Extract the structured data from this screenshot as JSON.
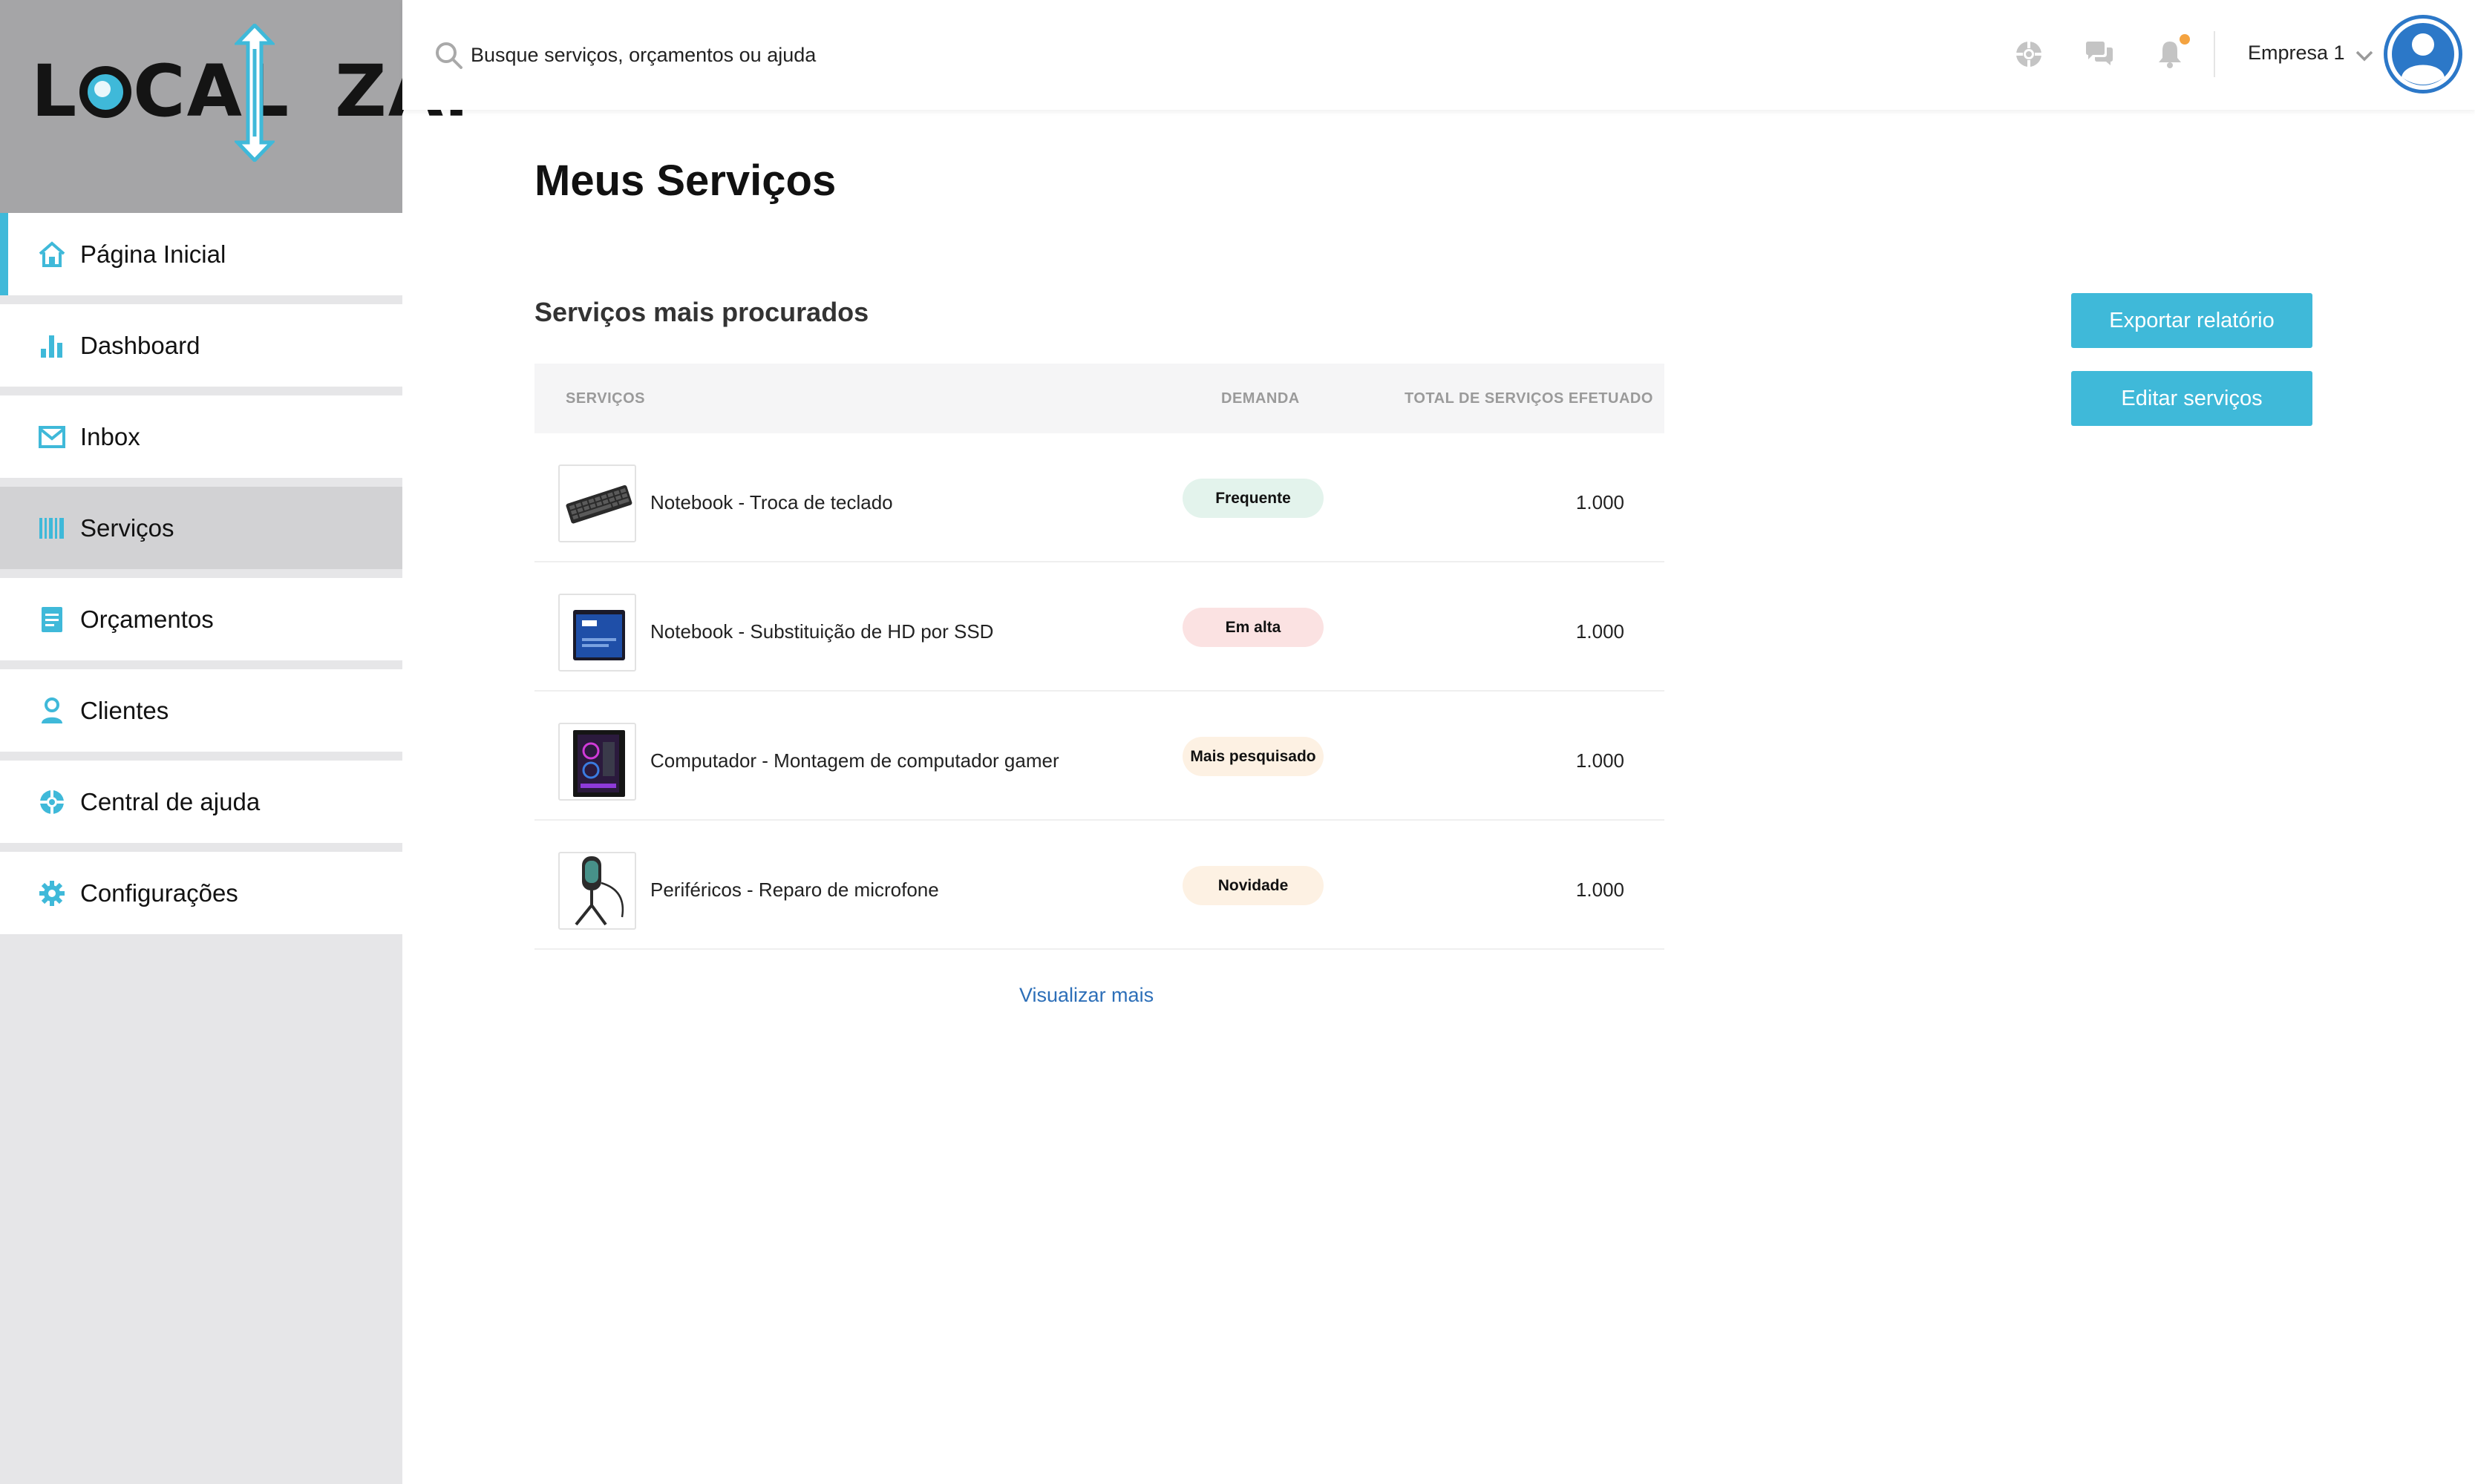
{
  "brand": {
    "logo_text_left": "LOC",
    "logo_text_mid": "AL",
    "logo_text_right": "ZA",
    "logo_text_full": "LOCALIZAi",
    "accent_color": "#3fb9d9"
  },
  "sidebar": {
    "items": [
      {
        "label": "Página Inicial",
        "icon": "home-icon"
      },
      {
        "label": "Dashboard",
        "icon": "bar-chart-icon"
      },
      {
        "label": "Inbox",
        "icon": "mail-icon"
      },
      {
        "label": "Serviços",
        "icon": "barcode-icon",
        "selected": true
      },
      {
        "label": "Orçamentos",
        "icon": "document-icon"
      },
      {
        "label": "Clientes",
        "icon": "user-icon"
      },
      {
        "label": "Central de ajuda",
        "icon": "lifebuoy-icon"
      },
      {
        "label": "Configurações",
        "icon": "gear-icon"
      }
    ]
  },
  "topbar": {
    "search_placeholder": "Busque serviços, orçamentos ou ajuda",
    "company": "Empresa 1",
    "icons": [
      "help-icon",
      "chat-icon",
      "bell-icon"
    ],
    "notification_color": "#f4a340"
  },
  "main": {
    "page_title": "Meus Serviços",
    "section_title": "Serviços mais procurados",
    "export_button": "Exportar relatório",
    "edit_button": "Editar serviços",
    "view_more": "Visualizar mais",
    "table": {
      "columns": [
        "SERVIÇOS",
        "DEMANDA",
        "TOTAL DE SERVIÇOS EFETUADO"
      ],
      "rows": [
        {
          "name": "Notebook - Troca de teclado",
          "demand": "Frequente",
          "demand_color": "#e3f3ec",
          "total": "1.000",
          "thumb": "keyboard-image"
        },
        {
          "name": "Notebook - Substituição de HD por SSD",
          "demand": "Em alta",
          "demand_color": "#fbe2e2",
          "total": "1.000",
          "thumb": "ssd-image"
        },
        {
          "name": "Computador - Montagem de computador gamer",
          "demand": "Mais pesquisado",
          "demand_color": "#fdf1e3",
          "total": "1.000",
          "thumb": "gamer-pc-image"
        },
        {
          "name": "Periféricos - Reparo de microfone",
          "demand": "Novidade",
          "demand_color": "#fdf1e3",
          "total": "1.000",
          "thumb": "microphone-image"
        }
      ]
    }
  }
}
